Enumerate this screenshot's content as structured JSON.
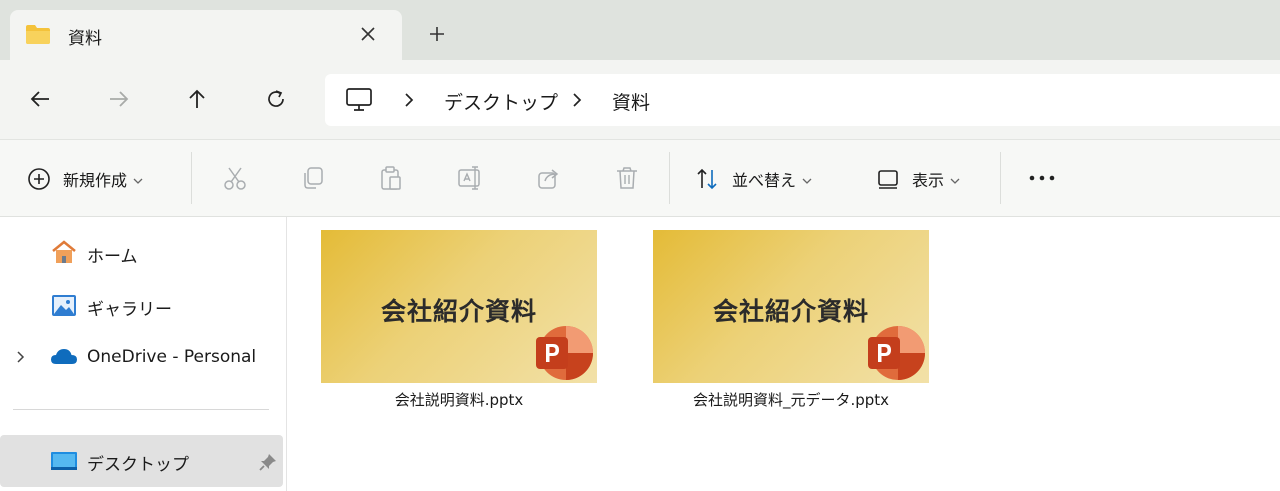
{
  "tab": {
    "title": "資料",
    "icon": "folder-icon",
    "close_icon": "close-icon",
    "new_tab_icon": "plus-icon"
  },
  "nav": {
    "back_icon": "arrow-left-icon",
    "forward_icon": "arrow-right-icon",
    "up_icon": "arrow-up-icon",
    "refresh_icon": "refresh-icon"
  },
  "address": {
    "root_icon": "monitor-icon",
    "crumbs": [
      "デスクトップ",
      "資料"
    ]
  },
  "toolbar": {
    "new_label": "新規作成",
    "sort_label": "並べ替え",
    "view_label": "表示",
    "more_icon": "more-icon",
    "disabled_icons": [
      "cut-icon",
      "copy-icon",
      "paste-icon",
      "rename-icon",
      "share-icon",
      "delete-icon"
    ]
  },
  "sidebar": {
    "items": [
      {
        "label": "ホーム",
        "icon": "home-icon"
      },
      {
        "label": "ギャラリー",
        "icon": "gallery-icon"
      },
      {
        "label": "OneDrive - Personal",
        "icon": "cloud-icon"
      },
      {
        "label": "デスクトップ",
        "icon": "desktop-icon",
        "pinned": true,
        "selected": true
      }
    ]
  },
  "files": [
    {
      "name": "会社説明資料.pptx",
      "thumbnail_text": "会社紹介資料",
      "icon": "powerpoint-icon"
    },
    {
      "name": "会社説明資料_元データ.pptx",
      "thumbnail_text": "会社紹介資料",
      "icon": "powerpoint-icon"
    }
  ],
  "colors": {
    "accent_ppt": "#c43e1c",
    "thumb_gold": "#e4bb37",
    "folder_yellow": "#f4c23a",
    "onedrive_blue": "#0f6cbd"
  }
}
